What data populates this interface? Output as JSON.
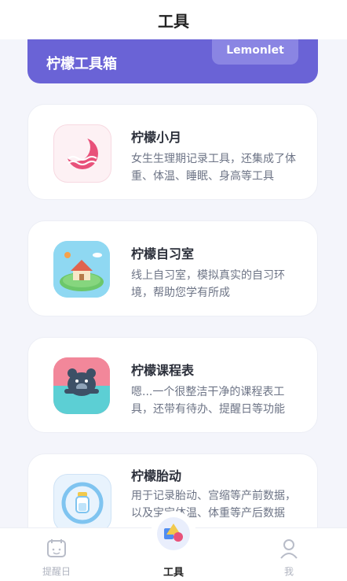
{
  "header": {
    "title": "工具"
  },
  "banner": {
    "title": "柠檬工具箱",
    "tag": "Lemonlet"
  },
  "tools": [
    {
      "name": "柠檬小月",
      "desc": "女生生理期记录工具，还集成了体重、体温、睡眠、身高等工具",
      "icon": "moon-icon"
    },
    {
      "name": "柠檬自习室",
      "desc": "线上自习室，模拟真实的自习环境，帮助您学有所成",
      "icon": "house-island-icon"
    },
    {
      "name": "柠檬课程表",
      "desc": "嗯...一个很整洁干净的课程表工具，还带有待办、提醒日等功能",
      "icon": "bear-icon"
    },
    {
      "name": "柠檬胎动",
      "desc": "用于记录胎动、宫缩等产前数据，以及宝宝体温、体重等产后数据",
      "icon": "baby-bottle-icon"
    }
  ],
  "tabbar": {
    "items": [
      {
        "label": "提醒日",
        "icon": "calendar-icon",
        "active": false
      },
      {
        "label": "工具",
        "icon": "shapes-icon",
        "active": true
      },
      {
        "label": "我",
        "icon": "person-icon",
        "active": false
      }
    ]
  },
  "colors": {
    "accent": "#6a63d6",
    "moon": "#e8517a",
    "background": "#f4f5fb"
  }
}
